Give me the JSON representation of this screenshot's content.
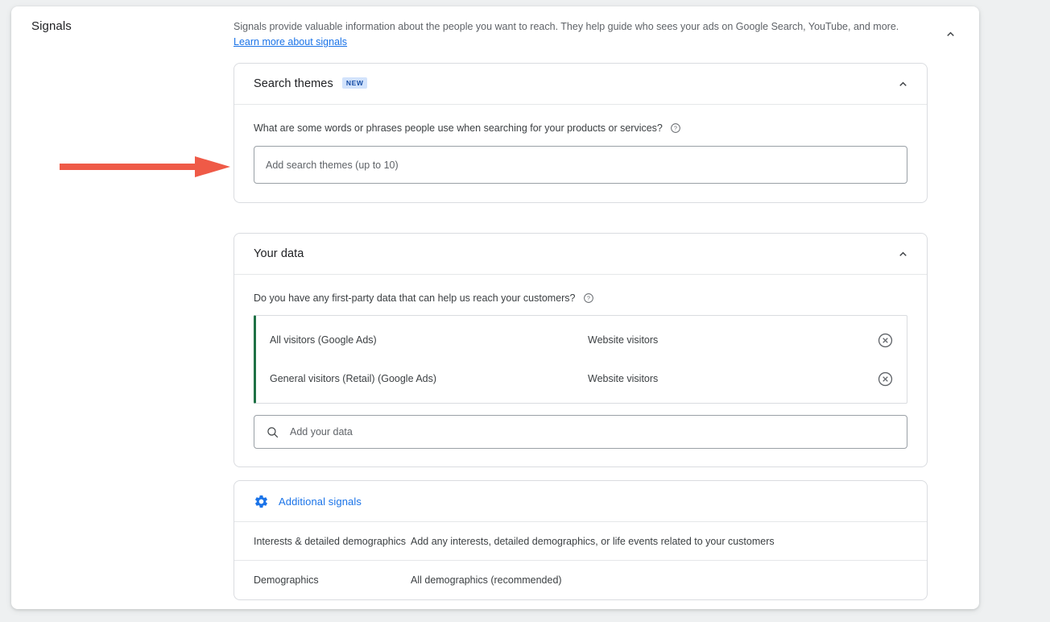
{
  "section": {
    "title": "Signals",
    "description_part1": "Signals provide valuable information about the people you want to reach. They help guide who sees your ads on Google Search, YouTube, and more. ",
    "learn_more_link": "Learn more about signals",
    "collapse_icon": "chevron-up-icon"
  },
  "search_themes": {
    "title": "Search themes",
    "badge": "NEW",
    "question": "What are some words or phrases people use when searching for your products or services?",
    "help_icon": "help-circle-icon",
    "input_placeholder": "Add search themes (up to 10)",
    "input_value": "",
    "collapse_icon": "chevron-up-icon"
  },
  "your_data": {
    "title": "Your data",
    "question": "Do you have any first-party data that can help us reach your customers?",
    "help_icon": "help-circle-icon",
    "collapse_icon": "chevron-up-icon",
    "accent_color": "#1e7145",
    "rows": [
      {
        "name": "All visitors (Google Ads)",
        "type": "Website visitors",
        "remove_icon": "cancel-circle-icon"
      },
      {
        "name": "General visitors (Retail) (Google Ads)",
        "type": "Website visitors",
        "remove_icon": "cancel-circle-icon"
      }
    ],
    "search_placeholder": "Add your data",
    "search_value": "",
    "search_icon": "search-icon"
  },
  "additional_signals": {
    "title": "Additional signals",
    "icon": "gear-icon",
    "link_color": "#1a73e8",
    "rows": [
      {
        "label": "Interests & detailed demographics",
        "value": "Add any interests, detailed demographics, or life events related to your customers"
      },
      {
        "label": "Demographics",
        "value": "All demographics (recommended)"
      }
    ]
  },
  "annotation": {
    "arrow_color": "#ef5a47",
    "arrow_name": "red-pointer-arrow"
  }
}
